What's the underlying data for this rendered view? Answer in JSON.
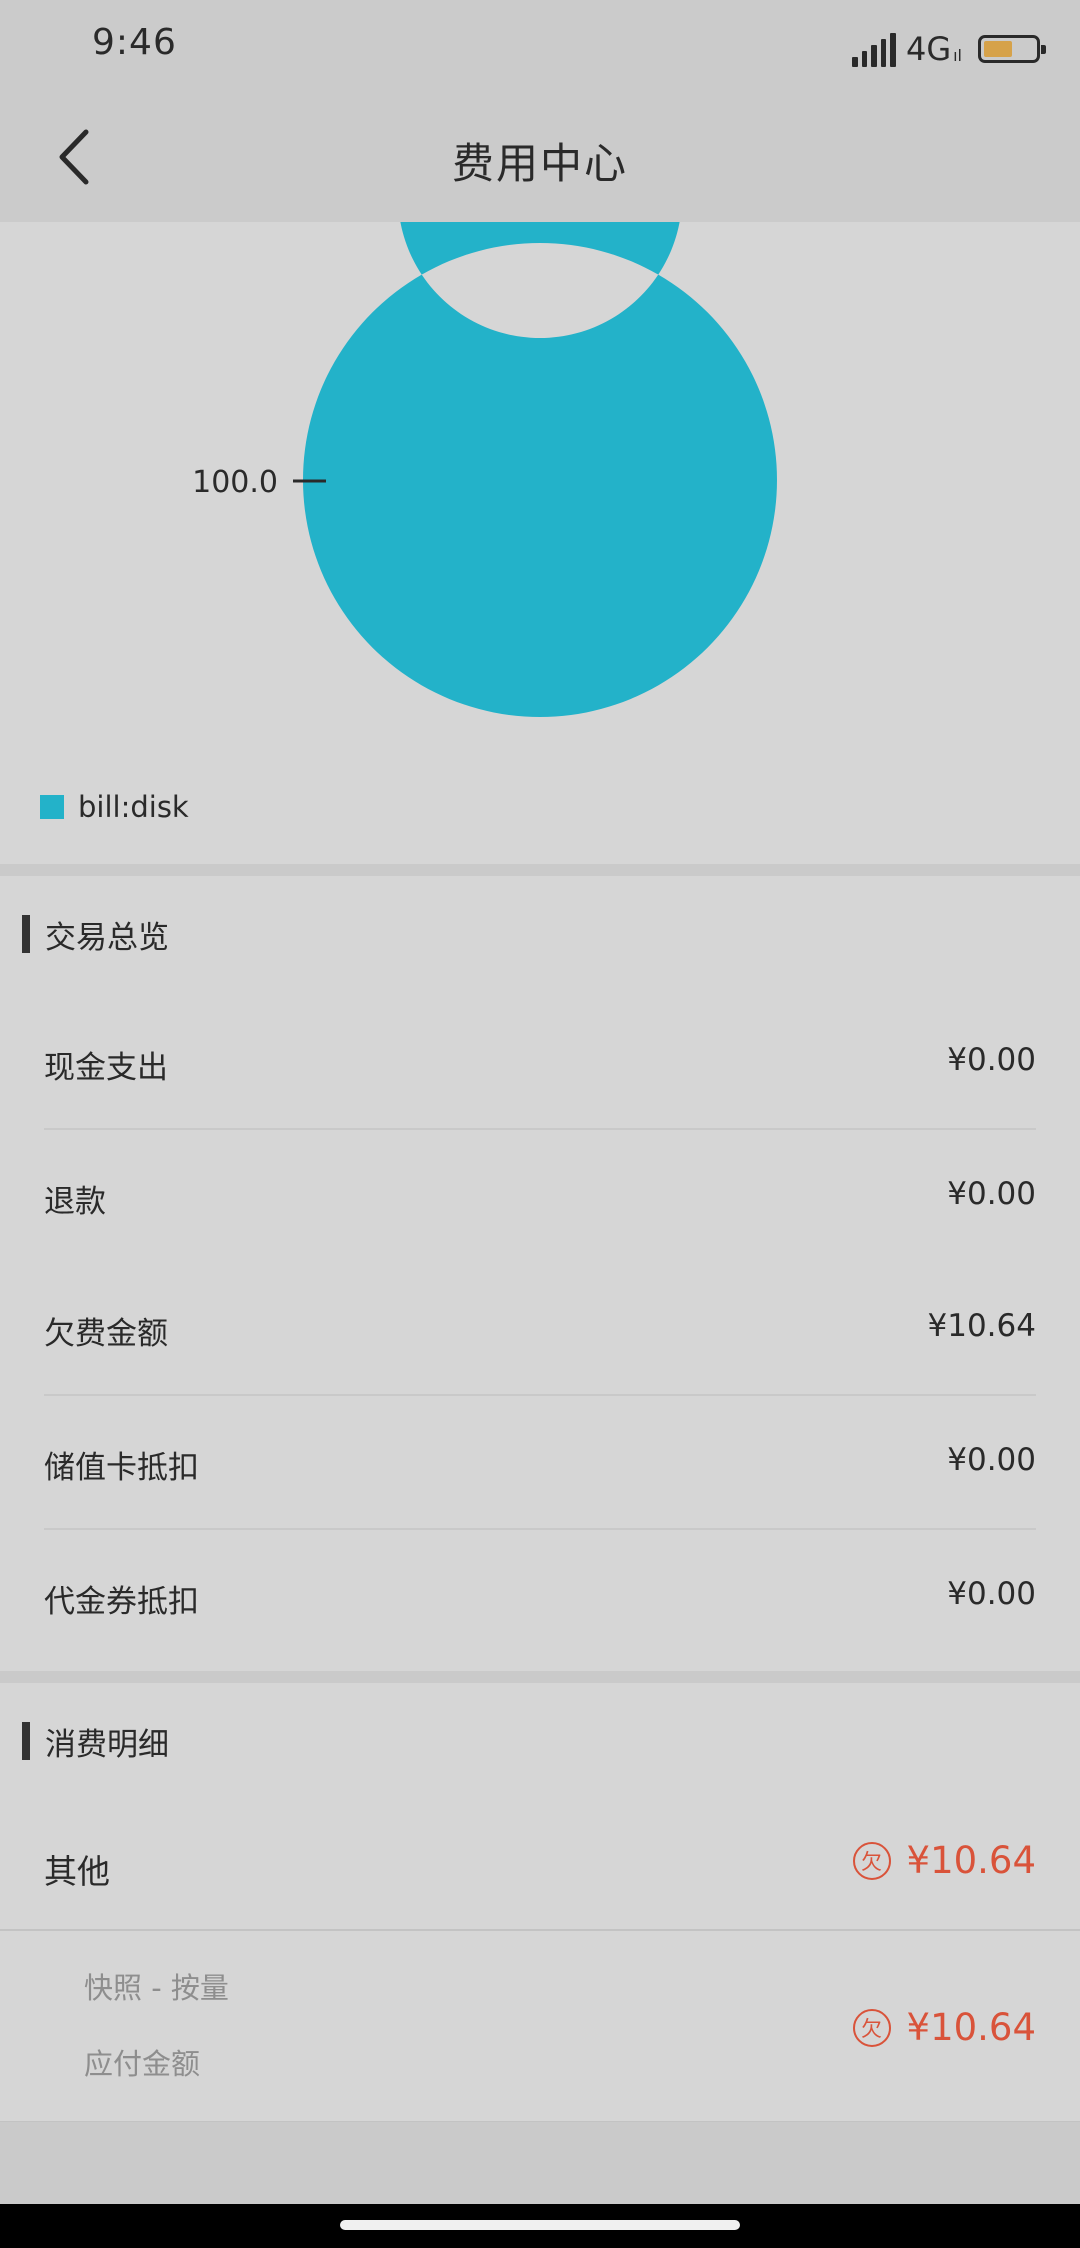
{
  "status_bar": {
    "time": "9:46",
    "network": "4G",
    "network_sub": "ıl",
    "battery_level": 0.55,
    "battery_color": "#d6a24a"
  },
  "nav": {
    "title": "费用中心",
    "back_icon": "chevron-left-icon"
  },
  "chart_data": {
    "type": "pie",
    "donut": true,
    "slices": [
      {
        "label": "bill:disk",
        "value": 100.0,
        "color": "#23b2c9"
      }
    ],
    "data_labels": [
      "100.0"
    ],
    "legend": [
      "bill:disk"
    ],
    "legend_position": "bottom-left"
  },
  "overview": {
    "title": "交易总览",
    "rows": [
      {
        "label": "现金支出",
        "value": "¥0.00"
      },
      {
        "label": "退款",
        "value": "¥0.00"
      },
      {
        "label": "欠费金额",
        "value": "¥10.64"
      },
      {
        "label": "储值卡抵扣",
        "value": "¥0.00"
      },
      {
        "label": "代金券抵扣",
        "value": "¥0.00"
      }
    ]
  },
  "details": {
    "title": "消费明细",
    "item": {
      "label": "其他",
      "owe_badge": "欠",
      "amount": "¥10.64"
    },
    "sub_item": {
      "name": "快照 - 按量",
      "caption": "应付金额",
      "owe_badge": "欠",
      "amount": "¥10.64"
    }
  },
  "colors": {
    "accent_red": "#d9533a",
    "chart_cyan": "#23b2c9"
  }
}
